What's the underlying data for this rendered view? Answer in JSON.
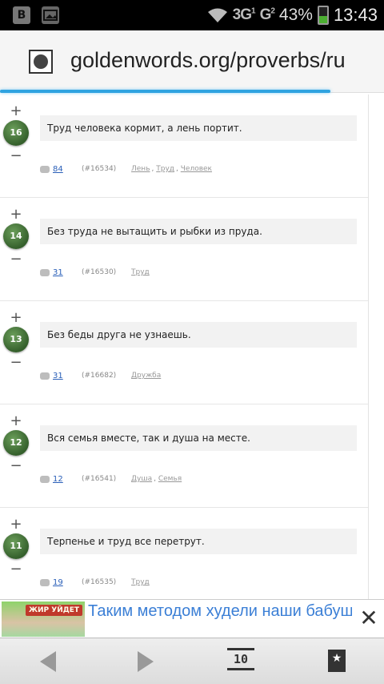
{
  "status_bar": {
    "left_icons": [
      "vk-icon",
      "gallery-icon"
    ],
    "vk_letter": "B",
    "network_1": "3G",
    "network_1_sub": "1",
    "network_2": "G",
    "network_2_sub": "2",
    "battery_percent": "43%",
    "battery_level": 0.43,
    "time": "13:43"
  },
  "browser": {
    "url": "goldenwords.org/proverbs/ru",
    "page_load_progress": 0.86
  },
  "proverbs": [
    {
      "rating": "16",
      "text": "Труд человека кормит, а лень портит.",
      "comments": "84",
      "id": "(#16534)",
      "tags": [
        "Лень",
        "Труд",
        "Человек"
      ]
    },
    {
      "rating": "14",
      "text": "Без труда не вытащить и рыбки из пруда.",
      "comments": "31",
      "id": "(#16530)",
      "tags": [
        "Труд"
      ]
    },
    {
      "rating": "13",
      "text": "Без беды друга не узнаешь.",
      "comments": "31",
      "id": "(#16682)",
      "tags": [
        "Дружба"
      ]
    },
    {
      "rating": "12",
      "text": "Вся семья вместе, так и душа на месте.",
      "comments": "12",
      "id": "(#16541)",
      "tags": [
        "Душа",
        "Семья"
      ]
    },
    {
      "rating": "11",
      "text": "Терпенье и труд все перетрут.",
      "comments": "19",
      "id": "(#16535)",
      "tags": [
        "Труд"
      ]
    }
  ],
  "vote": {
    "plus": "+",
    "minus": "−"
  },
  "ad": {
    "image_label": "ЖИР УЙДЕТ",
    "text": "Таким методом худели наши бабушки в СССР! Жир как огня",
    "close": "✕"
  },
  "nav": {
    "tabs_label": "10"
  }
}
